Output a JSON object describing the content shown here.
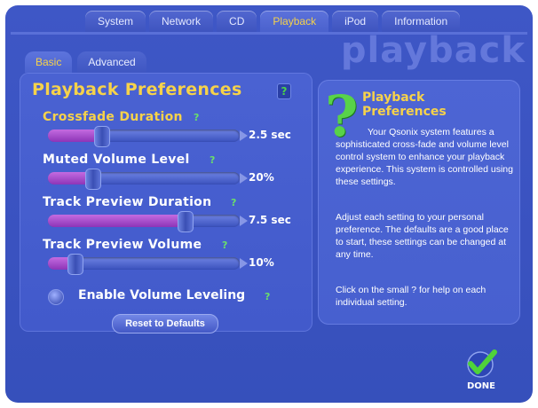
{
  "top_tabs": [
    {
      "label": "System"
    },
    {
      "label": "Network"
    },
    {
      "label": "CD"
    },
    {
      "label": "Playback"
    },
    {
      "label": "iPod"
    },
    {
      "label": "Information"
    }
  ],
  "active_top_tab": "Playback",
  "watermark": "playback",
  "sub_tabs": [
    {
      "label": "Basic"
    },
    {
      "label": "Advanced"
    }
  ],
  "active_sub_tab": "Basic",
  "panel_title": "Playback Preferences",
  "help_glyph": "?",
  "sliders": [
    {
      "label": "Crossfade Duration",
      "value": "2.5 sec",
      "fraction": 0.26
    },
    {
      "label": "Muted Volume Level",
      "value": "20%",
      "fraction": 0.21
    },
    {
      "label": "Track Preview Duration",
      "value": "7.5 sec",
      "fraction": 0.73
    },
    {
      "label": "Track Preview Volume",
      "value": "10%",
      "fraction": 0.11
    }
  ],
  "volume_leveling": {
    "label": "Enable Volume Leveling",
    "checked": false
  },
  "reset_button": "Reset to Defaults",
  "help": {
    "title_line1": "Playback",
    "title_line2": "Preferences",
    "paragraph1": "Your Qsonix system features a sophisticated cross-fade and volume level control system to enhance your playback experience. This system is controlled using these settings.",
    "paragraph2": "Adjust each setting to your personal preference. The defaults are a good place to start, these settings can be changed at any time.",
    "paragraph3": "Click on the small ? for help on each individual setting."
  },
  "done_label": "DONE",
  "colors": {
    "background": "#3e57c6",
    "accent_yellow": "#f6d24a",
    "help_green": "#58d24a",
    "slider_fill": "#a64fd0"
  },
  "icons": {
    "help": "question-mark-icon",
    "done": "checkmark-icon"
  }
}
